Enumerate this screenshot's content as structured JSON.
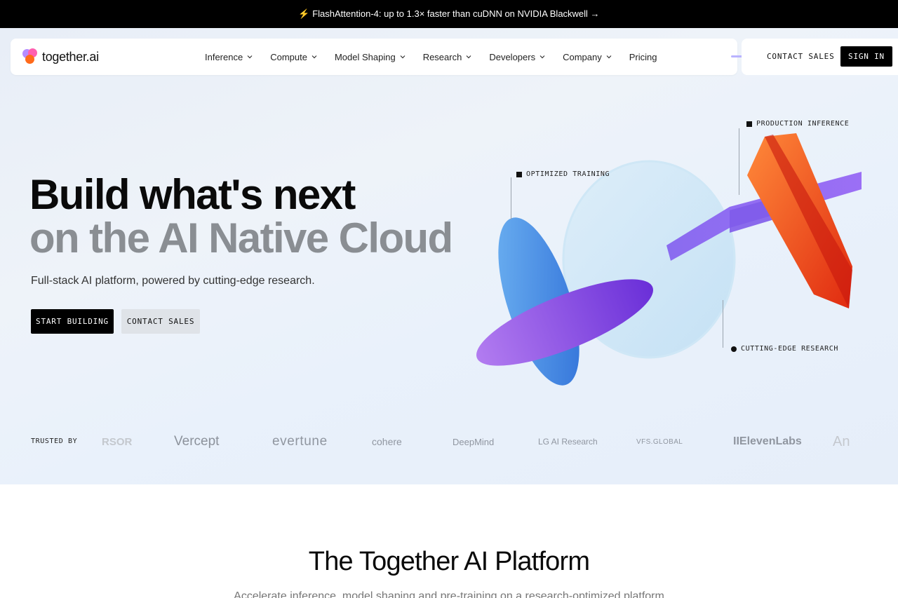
{
  "announcement": {
    "icon": "lightning-icon",
    "text": "⚡ FlashAttention-4: up to 1.3× faster than cuDNN on NVIDIA Blackwell →"
  },
  "brand": {
    "name": "together.ai",
    "colors": {
      "pink": "#ff5fb0",
      "purple": "#8a4dff",
      "orange": "#ff6a1a"
    }
  },
  "nav": {
    "items": [
      {
        "label": "Inference",
        "has_menu": true
      },
      {
        "label": "Compute",
        "has_menu": true
      },
      {
        "label": "Model Shaping",
        "has_menu": true
      },
      {
        "label": "Research",
        "has_menu": true
      },
      {
        "label": "Developers",
        "has_menu": true
      },
      {
        "label": "Company",
        "has_menu": true
      },
      {
        "label": "Pricing",
        "has_menu": false
      }
    ],
    "contact_sales": "CONTACT SALES",
    "sign_in": "SIGN IN"
  },
  "hero": {
    "headline_line1": "Build what's next",
    "headline_line2": "on the AI Native Cloud",
    "subtitle": "Full-stack AI platform, powered by cutting-edge research.",
    "cta_primary": "START BUILDING",
    "cta_secondary": "CONTACT SALES",
    "callouts": {
      "production": "PRODUCTION INFERENCE",
      "training": "OPTIMIZED TRAINING",
      "research": "CUTTING-EDGE RESEARCH"
    }
  },
  "trusted": {
    "label": "TRUSTED BY",
    "logos": [
      "RSOR",
      "Vercept",
      "evertune",
      "cohere",
      "DeepMind",
      "LG AI Research",
      "VFS.GLOBAL",
      "IIElevenLabs",
      "An"
    ]
  },
  "platform": {
    "title": "The Together AI Platform",
    "subtitle": "Accelerate inference, model shaping and pre-training on a research-optimized platform"
  }
}
